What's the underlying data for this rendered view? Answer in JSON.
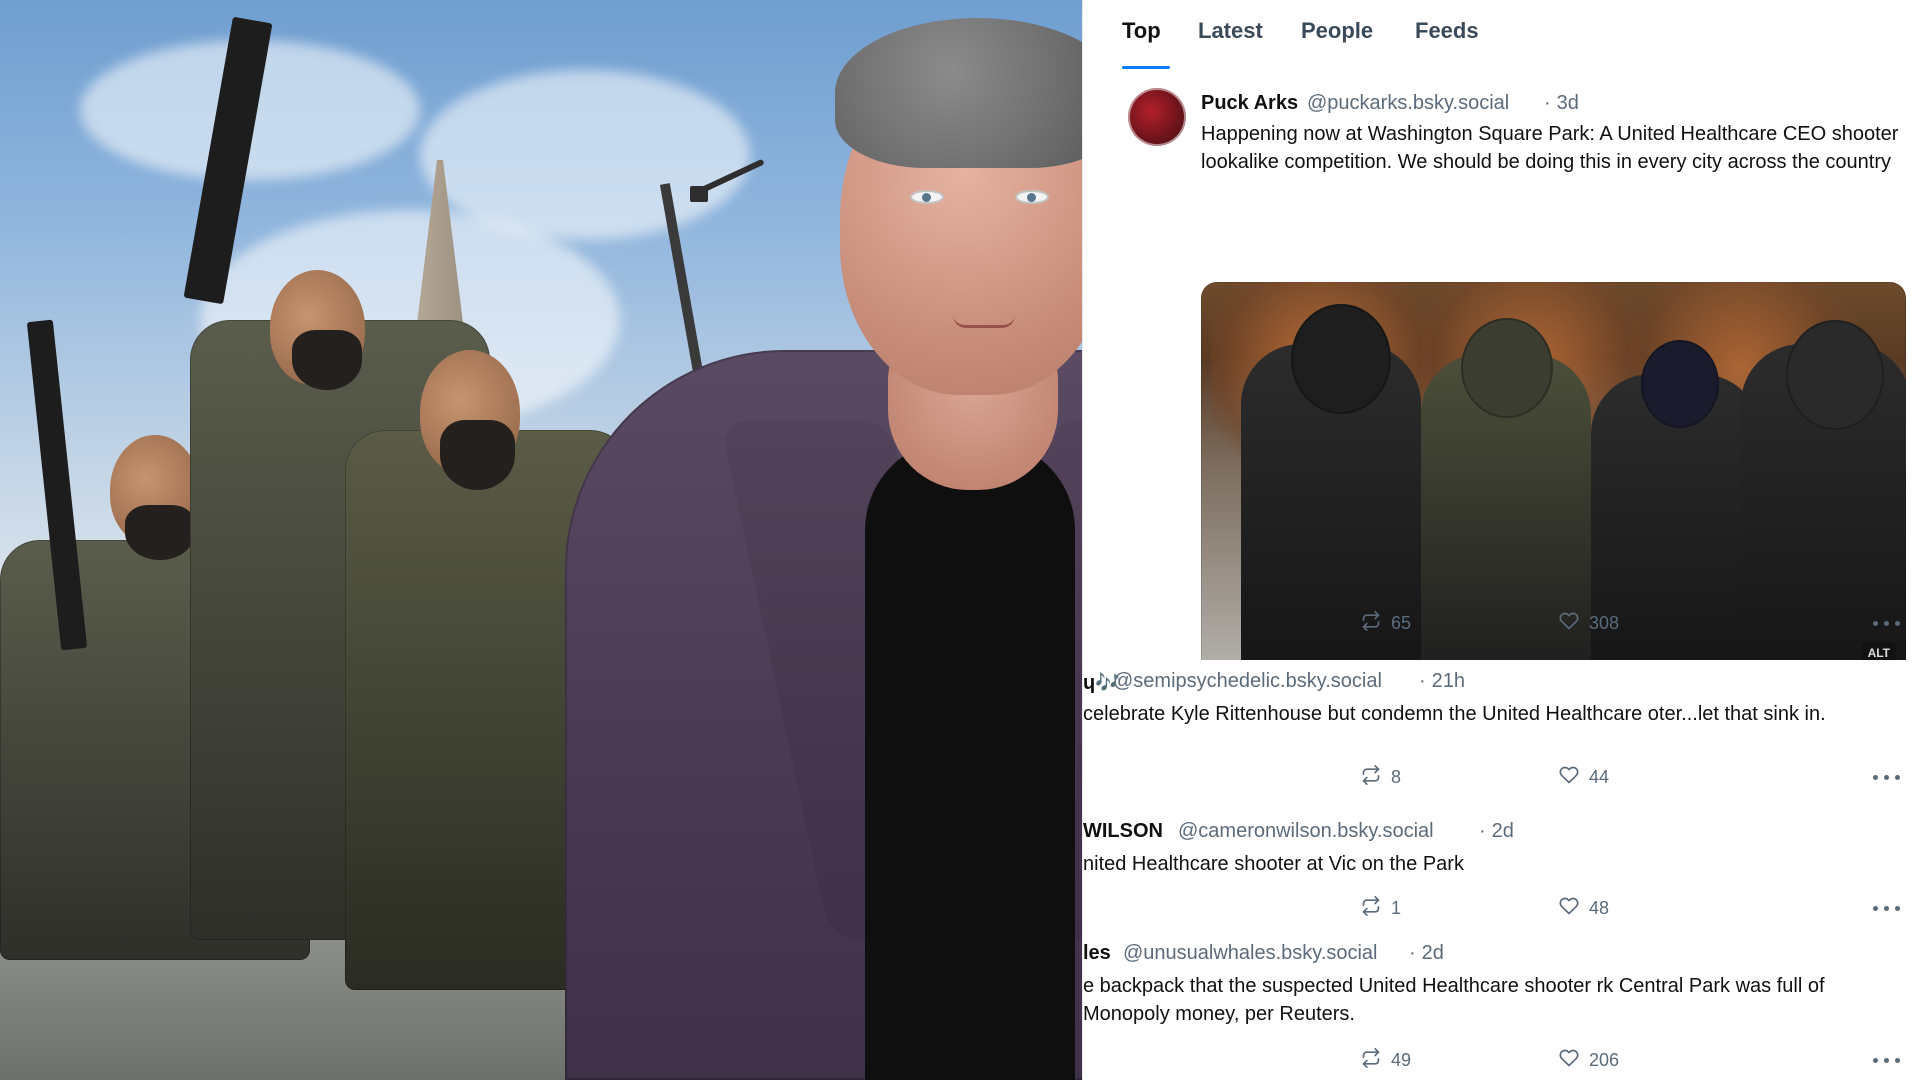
{
  "feed": {
    "tabs": [
      {
        "label": "Top"
      },
      {
        "label": "Latest"
      },
      {
        "label": "People"
      },
      {
        "label": "Feeds"
      }
    ],
    "posts": [
      {
        "author": "Puck Arks",
        "handle": "@puckarks.bsky.social",
        "time": "3d",
        "text": "Happening now at Washington Square Park: A United Healthcare CEO shooter lookalike competition. We should be doing this in every city across the country",
        "media_alt_badge": "ALT",
        "reposts": "65",
        "likes": "308"
      },
      {
        "author": "ɥ🎶",
        "handle": "@semipsychedelic.bsky.social",
        "time": "21h",
        "text": "celebrate Kyle Rittenhouse but condemn the United Healthcare oter...let that sink in.",
        "reposts": "8",
        "likes": "44"
      },
      {
        "author": "WILSON",
        "handle": "@cameronwilson.bsky.social",
        "time": "2d",
        "text": "nited Healthcare shooter at Vic on the Park",
        "reposts": "1",
        "likes": "48"
      },
      {
        "author": "les",
        "handle": "@unusualwhales.bsky.social",
        "time": "2d",
        "text": "e backpack that the suspected United Healthcare shooter rk Central Park was full of Monopoly money, per Reuters.",
        "reposts": "49",
        "likes": "206"
      }
    ]
  },
  "colors": {
    "accent": "#0a7aff",
    "muted": "#5b6b7b",
    "border": "#e6e9ee"
  },
  "icons": {
    "repost": "repost-icon",
    "like": "heart-icon",
    "more": "more-horizontal-icon"
  }
}
